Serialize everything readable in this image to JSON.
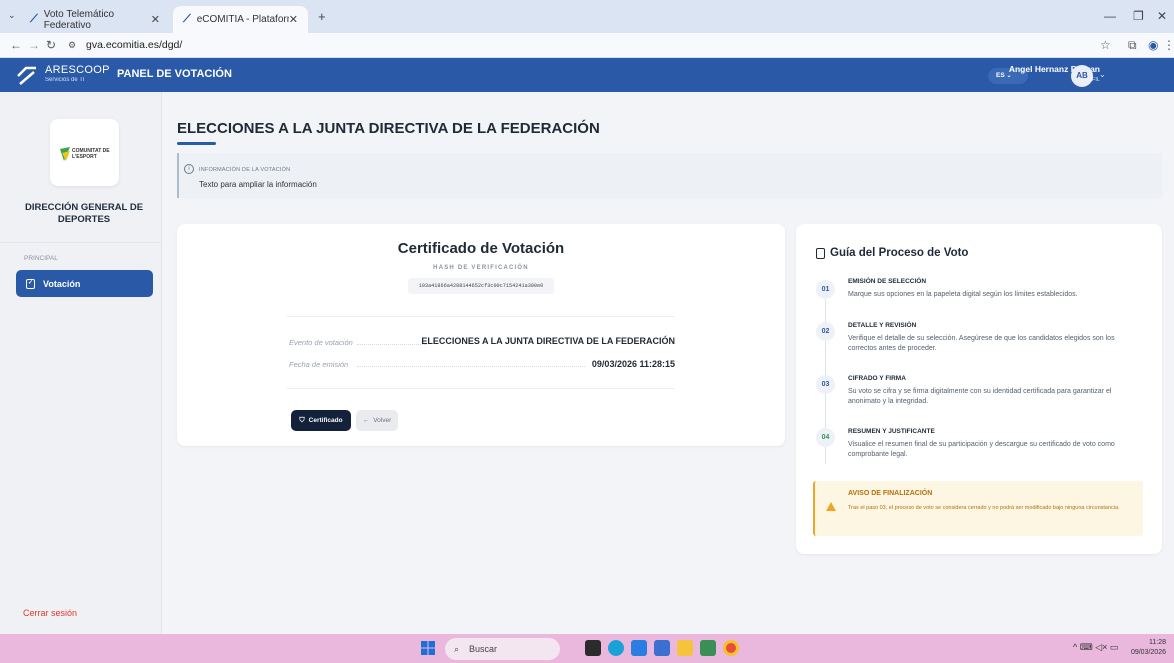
{
  "browser": {
    "tabs": [
      {
        "label": "Voto Telemático Federativo"
      },
      {
        "label": "eCOMITIA - Plataforma de Voto"
      }
    ],
    "url": "gva.ecomitia.es/dgd/"
  },
  "header": {
    "brand": "ARESCOOP",
    "brand_sub": "Servicios de TI",
    "panel_title": "PANEL DE VOTACIÓN",
    "lang": "ES",
    "user_name": "Angel Hernanz Beltran",
    "user_profile": "MI PERFIL",
    "avatar_initials": "AB"
  },
  "sidebar": {
    "org_logo_text": "COMUNITAT DE L'ESPORT",
    "org_name": "DIRECCIÓN GENERAL DE DEPORTES",
    "section": "PRINCIPAL",
    "items": [
      {
        "label": "Votación"
      }
    ],
    "logout": "Cerrar sesión"
  },
  "main": {
    "title": "ELECCIONES A LA JUNTA DIRECTIVA DE LA FEDERACIÓN",
    "info": {
      "title": "INFORMACIÓN DE LA VOTACIÓN",
      "text": "Texto para ampliar la información"
    },
    "certificate": {
      "title": "Certificado de Votación",
      "hash_label": "HASH DE VERIFICACIÓN",
      "hash": "103a41866a4288144652cf3c00c7154241a300e0",
      "rows": [
        {
          "label": "Evento de votación",
          "value": "ELECCIONES A LA JUNTA DIRECTIVA DE LA FEDERACIÓN"
        },
        {
          "label": "Fecha de emisión",
          "value": "09/03/2026 11:28:15"
        }
      ],
      "btn_certificate": "Certificado",
      "btn_back": "Volver"
    }
  },
  "guide": {
    "title": "Guía del Proceso de Voto",
    "steps": [
      {
        "num": "01",
        "title": "EMISIÓN DE SELECCIÓN",
        "desc": "Marque sus opciones en la papeleta digital según los límites establecidos."
      },
      {
        "num": "02",
        "title": "DETALLE Y REVISIÓN",
        "desc": "Verifique el detalle de su selección. Asegúrese de que los candidatos elegidos son los correctos antes de proceder."
      },
      {
        "num": "03",
        "title": "CIFRADO Y FIRMA",
        "desc": "Su voto se cifra y se firma digitalmente con su identidad certificada para garantizar el anonimato y la integridad."
      },
      {
        "num": "04",
        "title": "RESUMEN Y JUSTIFICANTE",
        "desc": "Visualice el resumen final de su participación y descargue su certificado de voto como comprobante legal."
      }
    ],
    "warning": {
      "title": "AVISO DE FINALIZACIÓN",
      "text": "Tras el paso 03, el proceso de voto se considera cerrado y no podrá ser modificado bajo ninguna circunstancia."
    }
  },
  "taskbar": {
    "search": "Buscar",
    "time": "11:28",
    "date": "09/03/2026"
  },
  "colors": {
    "primary": "#2a5aa7",
    "dark_button": "#13213a",
    "warning": "#f0a526",
    "logout": "#e0392b"
  }
}
